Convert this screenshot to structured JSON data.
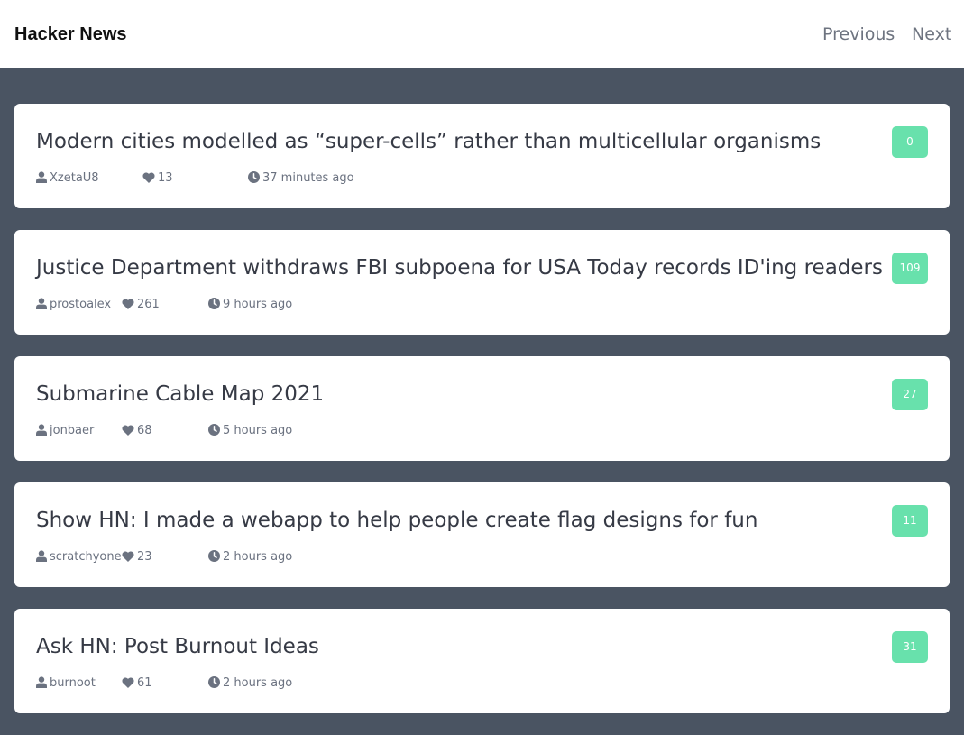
{
  "header": {
    "brand": "Hacker News",
    "previous_label": "Previous",
    "next_label": "Next"
  },
  "icons": {
    "user": "user-icon",
    "points": "heart-icon",
    "time": "clock-icon"
  },
  "colors": {
    "background": "#4a5462",
    "badge": "#68e1ac",
    "card": "#ffffff"
  },
  "stories": [
    {
      "title": "Modern cities modelled as “super-cells” rather than multicellular organisms",
      "comments": "0",
      "user": "XzetaU8",
      "points": "13",
      "time": "37 minutes ago"
    },
    {
      "title": "Justice Department withdraws FBI subpoena for USA Today records ID'ing readers",
      "comments": "109",
      "user": "prostoalex",
      "points": "261",
      "time": "9 hours ago"
    },
    {
      "title": "Submarine Cable Map 2021",
      "comments": "27",
      "user": "jonbaer",
      "points": "68",
      "time": "5 hours ago"
    },
    {
      "title": "Show HN: I made a webapp to help people create flag designs for fun",
      "comments": "11",
      "user": "scratchyone",
      "points": "23",
      "time": "2 hours ago"
    },
    {
      "title": "Ask HN: Post Burnout Ideas",
      "comments": "31",
      "user": "burnoot",
      "points": "61",
      "time": "2 hours ago"
    }
  ]
}
